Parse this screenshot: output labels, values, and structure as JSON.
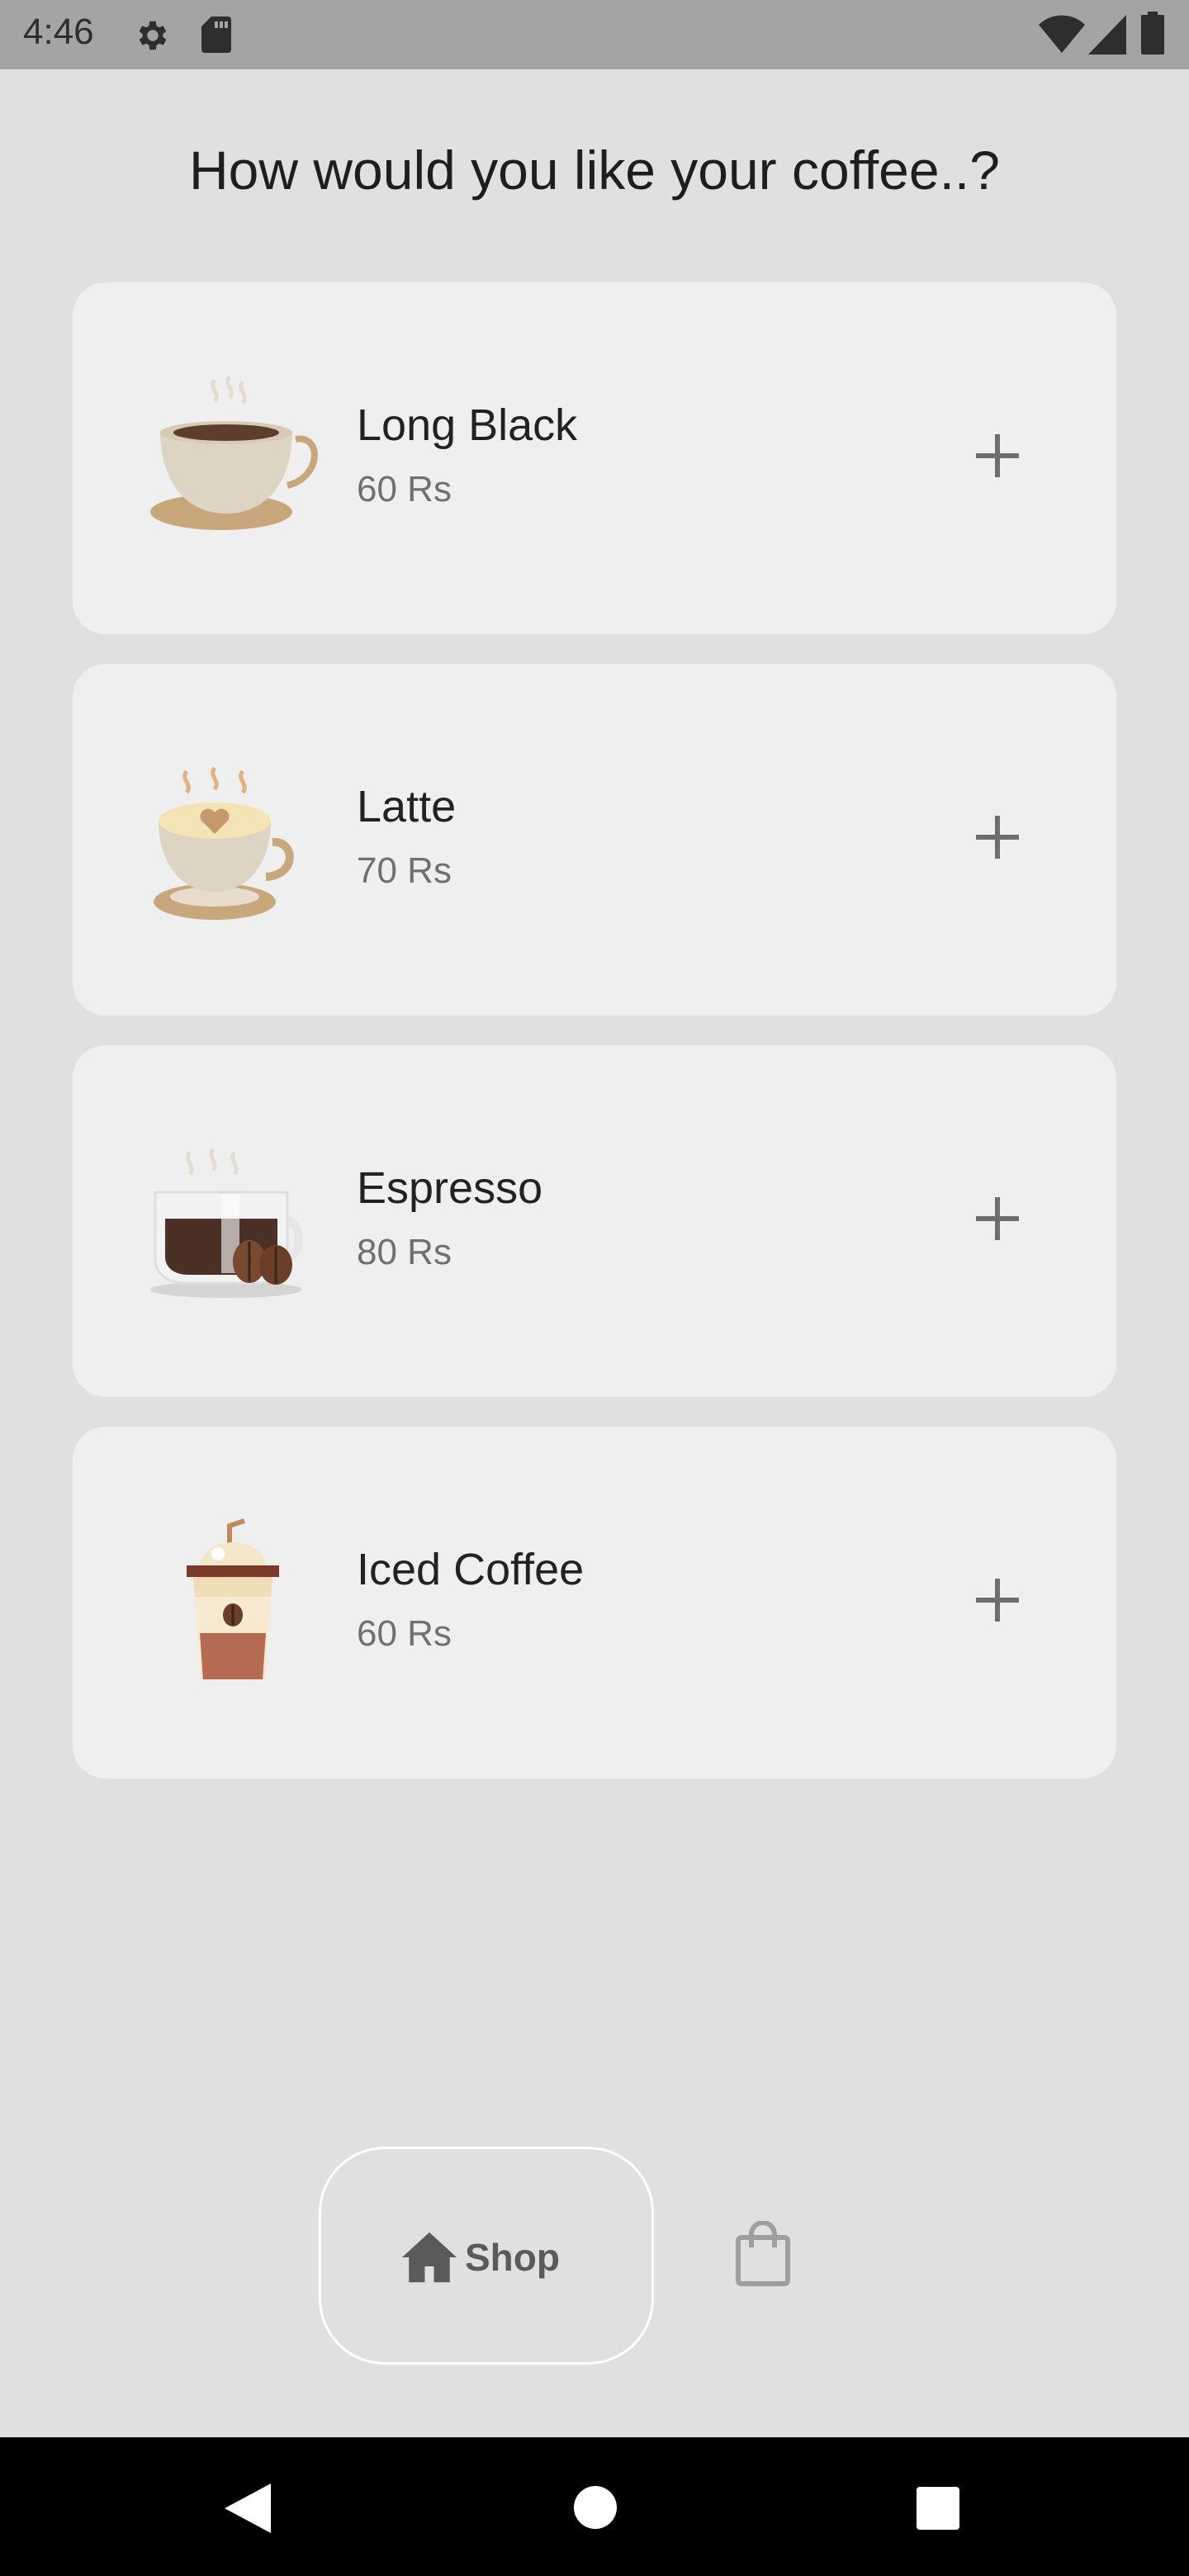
{
  "status_bar": {
    "time": "4:46",
    "icons": [
      "gear-icon",
      "sd-card-icon",
      "wifi-icon",
      "signal-icon",
      "battery-icon"
    ]
  },
  "page": {
    "title": "How would you like your coffee..?"
  },
  "products": [
    {
      "name": "Long Black",
      "price": "60 Rs",
      "image": "long-black-cup",
      "action_icon": "plus-icon"
    },
    {
      "name": "Latte",
      "price": "70 Rs",
      "image": "latte-cup",
      "action_icon": "plus-icon"
    },
    {
      "name": "Espresso",
      "price": "80 Rs",
      "image": "espresso-cup",
      "action_icon": "plus-icon"
    },
    {
      "name": "Iced Coffee",
      "price": "60 Rs",
      "image": "iced-coffee-cup",
      "action_icon": "plus-icon"
    }
  ],
  "bottom_nav": {
    "shop_label": "Shop",
    "shop_icon": "home-icon",
    "cart_icon": "shopping-bag-icon"
  },
  "system_nav": [
    "back-icon",
    "home-circle-icon",
    "recents-icon"
  ],
  "colors": {
    "background": "#e0e0e0",
    "card": "#efefef",
    "status_bar": "#a4a4a4",
    "accent_grey": "#5a5a5a"
  }
}
